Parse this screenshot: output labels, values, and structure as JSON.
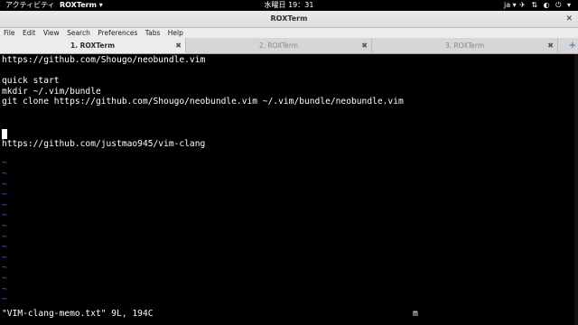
{
  "topbar": {
    "activities": "アクティビティ",
    "app_menu": "ROXTerm ▾",
    "clock": "水曜日 19：31",
    "lang": "ja ▾",
    "tray": [
      "✈",
      "⇅",
      "◐",
      "⏻ ▾"
    ]
  },
  "window": {
    "title": "ROXTerm",
    "close_glyph": "✕"
  },
  "menu": [
    "File",
    "Edit",
    "View",
    "Search",
    "Preferences",
    "Tabs",
    "Help"
  ],
  "tabs": [
    {
      "label": "1. ROXTerm",
      "active": true,
      "close": "✖"
    },
    {
      "label": "2. ROXTerm",
      "active": false,
      "close": "✖"
    },
    {
      "label": "3. ROXTerm",
      "active": false,
      "close": "✖"
    }
  ],
  "tab_add": "+",
  "terminal": {
    "lines": [
      "https://github.com/Shougo/neobundle.vim",
      "",
      "quick start",
      "mkdir ~/.vim/bundle",
      "git clone https://github.com/Shougo/neobundle.vim ~/.vim/bundle/neobundle.vim",
      "",
      "",
      "",
      "https://github.com/justmao945/vim-clang"
    ],
    "tilde": "~",
    "tilde_count": 14,
    "status_line": "\"VIM-clang-memo.txt\" 9L, 194C",
    "mode_indicator": "m"
  }
}
